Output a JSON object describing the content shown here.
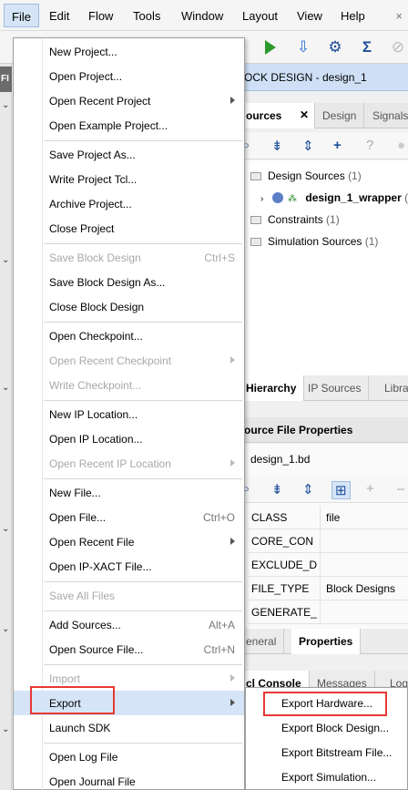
{
  "menubar": {
    "items": [
      "File",
      "Edit",
      "Flow",
      "Tools",
      "Window",
      "Layout",
      "View",
      "Help"
    ],
    "close_glyph": "×"
  },
  "left_strip": {
    "label": "FI"
  },
  "block_design_header": "OCK DESIGN - design_1",
  "sources_tabs": [
    "ources",
    "Design",
    "Signals"
  ],
  "sources_tree": [
    {
      "label": "Design Sources",
      "count": "(1)"
    },
    {
      "label": "design_1_wrapper",
      "suffix": "(d"
    },
    {
      "label": "Constraints",
      "count": "(1)"
    },
    {
      "label": "Simulation Sources",
      "count": "(1)"
    }
  ],
  "hierarchy_tabs": [
    "Hierarchy",
    "IP Sources",
    "Libra"
  ],
  "properties": {
    "title": "ource File Properties",
    "file_name": "design_1.bd",
    "rows": [
      {
        "key": "CLASS",
        "value": "file"
      },
      {
        "key": "CORE_CON",
        "value": ""
      },
      {
        "key": "EXCLUDE_D",
        "value": ""
      },
      {
        "key": "FILE_TYPE",
        "value": "Block Designs"
      },
      {
        "key": "GENERATE_",
        "value": ""
      }
    ],
    "tabs": [
      "eneral",
      "Properties"
    ]
  },
  "console_tabs": [
    "cl Console",
    "Messages",
    "Log"
  ],
  "file_menu": {
    "items": [
      {
        "label": "New Project...",
        "enabled": true
      },
      {
        "label": "Open Project...",
        "enabled": true
      },
      {
        "label": "Open Recent Project",
        "enabled": true,
        "submenu": true
      },
      {
        "label": "Open Example Project...",
        "enabled": true
      },
      {
        "label": "Save Project As...",
        "enabled": true
      },
      {
        "label": "Write Project Tcl...",
        "enabled": true
      },
      {
        "label": "Archive Project...",
        "enabled": true
      },
      {
        "label": "Close Project",
        "enabled": true
      },
      {
        "label": "Save Block Design",
        "enabled": false,
        "shortcut": "Ctrl+S"
      },
      {
        "label": "Save Block Design As...",
        "enabled": true
      },
      {
        "label": "Close Block Design",
        "enabled": true
      },
      {
        "label": "Open Checkpoint...",
        "enabled": true
      },
      {
        "label": "Open Recent Checkpoint",
        "enabled": false,
        "submenu": true
      },
      {
        "label": "Write Checkpoint...",
        "enabled": false
      },
      {
        "label": "New IP Location...",
        "enabled": true
      },
      {
        "label": "Open IP Location...",
        "enabled": true
      },
      {
        "label": "Open Recent IP Location",
        "enabled": false,
        "submenu": true
      },
      {
        "label": "New File...",
        "enabled": true
      },
      {
        "label": "Open File...",
        "enabled": true,
        "shortcut": "Ctrl+O"
      },
      {
        "label": "Open Recent File",
        "enabled": true,
        "submenu": true
      },
      {
        "label": "Open IP-XACT File...",
        "enabled": true
      },
      {
        "label": "Save All Files",
        "enabled": false
      },
      {
        "label": "Add Sources...",
        "enabled": true,
        "shortcut": "Alt+A"
      },
      {
        "label": "Open Source File...",
        "enabled": true,
        "shortcut": "Ctrl+N"
      },
      {
        "label": "Import",
        "enabled": false,
        "submenu": true
      },
      {
        "label": "Export",
        "enabled": true,
        "submenu": true,
        "highlighted": true
      },
      {
        "label": "Launch SDK",
        "enabled": true
      },
      {
        "label": "Open Log File",
        "enabled": true
      },
      {
        "label": "Open Journal File",
        "enabled": true
      }
    ]
  },
  "export_submenu": {
    "items": [
      "Export Hardware...",
      "Export Block Design...",
      "Export Bitstream File...",
      "Export Simulation..."
    ]
  },
  "colors": {
    "highlight": "#d5e5f7",
    "annotation_red": "#e53935",
    "header_blue": "#cfe0f6",
    "disabled_text": "#a8a8a8"
  }
}
